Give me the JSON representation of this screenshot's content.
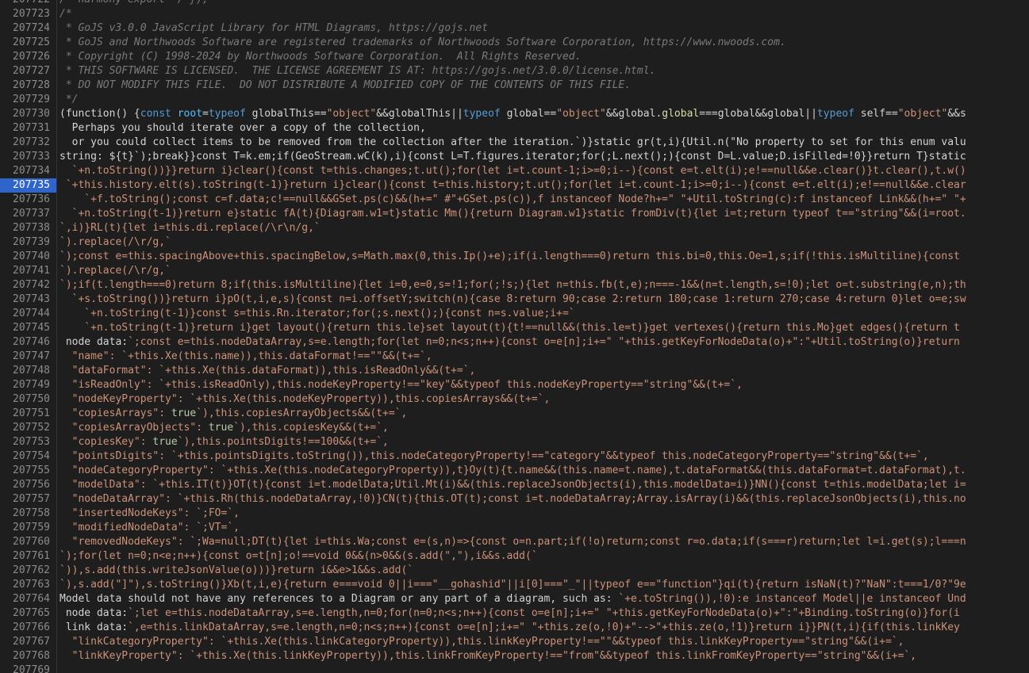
{
  "editor": {
    "active_line": "207735",
    "colors": {
      "background": "#1e1e1e",
      "active_line_number": "#2f65ca",
      "comment": "#7a7a7a",
      "keyword": "#569cd6",
      "string": "#ce9178",
      "plain": "#d4d4d4"
    },
    "lines": [
      {
        "n": "207722",
        "segs": [
          {
            "t": "cm",
            "v": "/* harmony export */ });"
          }
        ]
      },
      {
        "n": "207723",
        "segs": [
          {
            "t": "cm",
            "v": "/*"
          }
        ]
      },
      {
        "n": "207724",
        "segs": [
          {
            "t": "cm",
            "v": " * GoJS v3.0.0 JavaScript Library for HTML Diagrams, https://gojs.net"
          }
        ]
      },
      {
        "n": "207725",
        "segs": [
          {
            "t": "cm",
            "v": " * GoJS and Northwoods Software are registered trademarks of Northwoods Software Corporation, https://www.nwoods.com."
          }
        ]
      },
      {
        "n": "207726",
        "segs": [
          {
            "t": "cm",
            "v": " * Copyright (C) 1998-2024 by Northwoods Software Corporation.  All Rights Reserved."
          }
        ]
      },
      {
        "n": "207727",
        "segs": [
          {
            "t": "cm",
            "v": " * THIS SOFTWARE IS LICENSED.  THE LICENSE AGREEMENT IS AT: https://gojs.net/3.0.0/license.html."
          }
        ]
      },
      {
        "n": "207728",
        "segs": [
          {
            "t": "cm",
            "v": " * DO NOT MODIFY THIS FILE.  DO NOT DISTRIBUTE A MODIFIED COPY OF THE CONTENTS OF THIS FILE."
          }
        ]
      },
      {
        "n": "207729",
        "segs": [
          {
            "t": "cm",
            "v": " */"
          }
        ]
      },
      {
        "n": "207730",
        "segs": [
          {
            "t": "pl",
            "v": "(function() {"
          },
          {
            "t": "kw",
            "v": "const "
          },
          {
            "t": "var",
            "v": "root"
          },
          {
            "t": "pl",
            "v": "="
          },
          {
            "t": "kw",
            "v": "typeof "
          },
          {
            "t": "pl",
            "v": "globalThis=="
          },
          {
            "t": "str",
            "v": "\"object\""
          },
          {
            "t": "pl",
            "v": "&&globalThis||"
          },
          {
            "t": "kw",
            "v": "typeof "
          },
          {
            "t": "pl",
            "v": "global=="
          },
          {
            "t": "str",
            "v": "\"object\""
          },
          {
            "t": "pl",
            "v": "&&global."
          },
          {
            "t": "fn",
            "v": "global"
          },
          {
            "t": "pl",
            "v": "===global&&global||"
          },
          {
            "t": "kw",
            "v": "typeof "
          },
          {
            "t": "pl",
            "v": "self=="
          },
          {
            "t": "str",
            "v": "\"object\""
          },
          {
            "t": "pl",
            "v": "&&s"
          }
        ]
      },
      {
        "n": "207731",
        "segs": [
          {
            "t": "pl",
            "v": "  Perhaps you should iterate over a copy of the collection,"
          }
        ]
      },
      {
        "n": "207732",
        "segs": [
          {
            "t": "pl",
            "v": "  or you could collect items to be removed from the collection after the iteration.`)}static gr(t,i){Util.n(\"No property to set for this enum valu"
          }
        ]
      },
      {
        "n": "207733",
        "segs": [
          {
            "t": "pl",
            "v": "string: ${t}`);break}}const T=k.em;if(GeoStream.wC(k),i){const L=T.figures.iterator;for(;L.next();){const D=L.value;D.isFilled=!0}}return T}static"
          }
        ]
      },
      {
        "n": "207734",
        "segs": [
          {
            "t": "str",
            "v": "  `+n.toString())}}return i}clear(){const t=this.changes;t.ut();for(let i=t.count-1;i>=0;i--){const e=t.elt(i);e!==null&&e.clear()}t.clear(),t.w()"
          }
        ]
      },
      {
        "n": "207735",
        "segs": [
          {
            "t": "str",
            "v": " `+this.history.elt(s).toString(t-1)}return i}clear(){const t=this.history;t.ut();for(let i=t.count-1;i>=0;i--){const e=t.elt(i);e!==null&&e.clear"
          }
        ]
      },
      {
        "n": "207736",
        "segs": [
          {
            "t": "str",
            "v": "    `+f.toString();const c=f.data;c!==null&&GSet.ps(c)&&(h+=\" #\"+GSet.ps(c)),f instanceof Node?h+=\" \"+Util.toString(c):f instanceof Link&&(h+=\" \"+"
          }
        ]
      },
      {
        "n": "207737",
        "segs": [
          {
            "t": "str",
            "v": "  `+n.toString(t-1)}return e}static fA(t){Diagram.w1=t}static Mm(){return Diagram.w1}static fromDiv(t){let i=t;return typeof t==\"string\"&&(i=root."
          }
        ]
      },
      {
        "n": "207738",
        "segs": [
          {
            "t": "str",
            "v": "`,i)}RL(t){let i=this.di.replace(/\\r\\n/g,`"
          }
        ]
      },
      {
        "n": "207739",
        "segs": [
          {
            "t": "str",
            "v": "`).replace(/\\r/g,`"
          }
        ]
      },
      {
        "n": "207740",
        "segs": [
          {
            "t": "str",
            "v": "`);const e=this.spacingAbove+this.spacingBelow,s=Math.max(0,this.Ip()+e);if(i.length===0)return this.bi=0,this.Oe=1,s;if(!this.isMultiline){const"
          }
        ]
      },
      {
        "n": "207741",
        "segs": [
          {
            "t": "str",
            "v": "`).replace(/\\r/g,`"
          }
        ]
      },
      {
        "n": "207742",
        "segs": [
          {
            "t": "str",
            "v": "`);if(t.length===0)return 8;if(this.isMultiline){let i=0,e=0,s=!1;for(;!s;){let n=this.fb(t,e);n===-1&&(n=t.length,s=!0);let o=t.substring(e,n);th"
          }
        ]
      },
      {
        "n": "207743",
        "segs": [
          {
            "t": "str",
            "v": "  `+s.toString())}return i}pO(t,i,e,s){const n=i.offsetY;switch(n){case 8:return 90;case 2:return 180;case 1:return 270;case 4:return 0}let o=e;sw"
          }
        ]
      },
      {
        "n": "207744",
        "segs": [
          {
            "t": "str",
            "v": "    `+n.toString(t-1)}const s=this.Rn.iterator;for(;s.next();){const n=s.value;i+=`"
          }
        ]
      },
      {
        "n": "207745",
        "segs": [
          {
            "t": "str",
            "v": "    `+n.toString(t-1)}return i}get layout(){return this.le}set layout(t){t!==null&&(this.le=t)}get vertexes(){return this.Mo}get edges(){return t"
          }
        ]
      },
      {
        "n": "207746",
        "segs": [
          {
            "t": "pl",
            "v": " node data:"
          },
          {
            "t": "str",
            "v": "`;const e=this.nodeDataArray,s=e.length;for(let n=0;n<s;n++){const o=e[n];i+=\" \"+this.getKeyForNodeData(o)+\":\"+Util.toString(o)}return"
          }
        ]
      },
      {
        "n": "207747",
        "segs": [
          {
            "t": "str",
            "v": "  \"name\": `+this.Xe(this.name)),this.dataFormat!==\"\"&&(t+=`,"
          }
        ]
      },
      {
        "n": "207748",
        "segs": [
          {
            "t": "str",
            "v": "  \"dataFormat\": `+this.Xe(this.dataFormat)),this.isReadOnly&&(t+=`,"
          }
        ]
      },
      {
        "n": "207749",
        "segs": [
          {
            "t": "str",
            "v": "  \"isReadOnly\": `+this.isReadOnly),this.nodeKeyProperty!==\"key\"&&typeof this.nodeKeyProperty==\"string\"&&(t+=`,"
          }
        ]
      },
      {
        "n": "207750",
        "segs": [
          {
            "t": "str",
            "v": "  \"nodeKeyProperty\": `+this.Xe(this.nodeKeyProperty)),this.copiesArrays&&(t+=`,"
          }
        ]
      },
      {
        "n": "207751",
        "segs": [
          {
            "t": "str",
            "v": "  \"copiesArrays\": "
          },
          {
            "t": "bool",
            "v": "true"
          },
          {
            "t": "str",
            "v": "`),this.copiesArrayObjects&&(t+=`,"
          }
        ]
      },
      {
        "n": "207752",
        "segs": [
          {
            "t": "str",
            "v": "  \"copiesArrayObjects\": "
          },
          {
            "t": "bool",
            "v": "true"
          },
          {
            "t": "str",
            "v": "`),this.copiesKey&&(t+=`,"
          }
        ]
      },
      {
        "n": "207753",
        "segs": [
          {
            "t": "str",
            "v": "  \"copiesKey\": "
          },
          {
            "t": "bool",
            "v": "true"
          },
          {
            "t": "str",
            "v": "`),this.pointsDigits!==100&&(t+=`,"
          }
        ]
      },
      {
        "n": "207754",
        "segs": [
          {
            "t": "str",
            "v": "  \"pointsDigits\": `+this.pointsDigits.toString()),this.nodeCategoryProperty!==\"category\"&&typeof this.nodeCategoryProperty==\"string\"&&(t+=`,"
          }
        ]
      },
      {
        "n": "207755",
        "segs": [
          {
            "t": "str",
            "v": "  \"nodeCategoryProperty\": `+this.Xe(this.nodeCategoryProperty)),t}Oy(t){t.name&&(this.name=t.name),t.dataFormat&&(this.dataFormat=t.dataFormat),t."
          }
        ]
      },
      {
        "n": "207756",
        "segs": [
          {
            "t": "str",
            "v": "  \"modelData\": `+this.IT(t)}OT(t){const i=t.modelData;Util.Mt(i)&&(this.replaceJsonObjects(i),this.modelData=i)}NN(){const t=this.modelData;let i="
          }
        ]
      },
      {
        "n": "207757",
        "segs": [
          {
            "t": "str",
            "v": "  \"nodeDataArray\": `+this.Rh(this.nodeDataArray,!0)}CN(t){this.OT(t);const i=t.nodeDataArray;Array.isArray(i)&&(this.replaceJsonObjects(i),this.no"
          }
        ]
      },
      {
        "n": "207758",
        "segs": [
          {
            "t": "str",
            "v": "  \"insertedNodeKeys\": `;FO=`,"
          }
        ]
      },
      {
        "n": "207759",
        "segs": [
          {
            "t": "str",
            "v": "  \"modifiedNodeData\": `;VT=`,"
          }
        ]
      },
      {
        "n": "207760",
        "segs": [
          {
            "t": "str",
            "v": "  \"removedNodeKeys\": `;Wa=null;DT(t){let i=this.Wa;const e=(s,n)=>{const o=n.part;if(!o)return;const r=o.data;if(s===r)return;let l=i.get(s);l===n"
          }
        ]
      },
      {
        "n": "207761",
        "segs": [
          {
            "t": "str",
            "v": "`);for(let n=0;n<e;n++){const o=t[n];o!==void 0&&(n>0&&(s.add(\",\"),i&&s.add(`"
          }
        ]
      },
      {
        "n": "207762",
        "segs": [
          {
            "t": "str",
            "v": "`)),s.add(this.writeJsonValue(o)))}return i&&e>1&&s.add(`"
          }
        ]
      },
      {
        "n": "207763",
        "segs": [
          {
            "t": "str",
            "v": "`),s.add(\"]\"),s.toString()}Xb(t,i,e){return e===void 0||i===\"__gohashid\"||i[0]===\"_\"||typeof e==\"function\"}qi(t){return isNaN(t)?\"NaN\":t===1/0?\"9e"
          }
        ]
      },
      {
        "n": "207764",
        "segs": [
          {
            "t": "pl",
            "v": "Model data should not have any references to a Diagram or any part of a diagram, such as: "
          },
          {
            "t": "str",
            "v": "`+e.toString()),!0):e instanceof Model||e instanceof Und"
          }
        ]
      },
      {
        "n": "207765",
        "segs": [
          {
            "t": "pl",
            "v": " node data:"
          },
          {
            "t": "str",
            "v": "`;let e=this.nodeDataArray,s=e.length,n=0;for(n=0;n<s;n++){const o=e[n];i+=\" \"+this.getKeyForNodeData(o)+\":\"+Binding.toString(o)}for(i"
          }
        ]
      },
      {
        "n": "207766",
        "segs": [
          {
            "t": "pl",
            "v": " link data:"
          },
          {
            "t": "str",
            "v": "`,e=this.linkDataArray,s=e.length,n=0;n<s;n++){const o=e[n];i+=\" \"+this.ze(o,!0)+\"-->\"+this.ze(o,!1)}return i}}PN(t,i){if(this.linkKey"
          }
        ]
      },
      {
        "n": "207767",
        "segs": [
          {
            "t": "str",
            "v": "  \"linkCategoryProperty\": `+this.Xe(this.linkCategoryProperty)),this.linkKeyProperty!==\"\"&&typeof this.linkKeyProperty==\"string\"&&(i+=`,"
          }
        ]
      },
      {
        "n": "207768",
        "segs": [
          {
            "t": "str",
            "v": "  \"linkKeyProperty\": `+this.Xe(this.linkKeyProperty)),this.linkFromKeyProperty!==\"from\"&&typeof this.linkFromKeyProperty==\"string\"&&(i+=`,"
          }
        ]
      },
      {
        "n": "207769",
        "segs": [
          {
            "t": "str",
            "v": ""
          }
        ]
      }
    ]
  }
}
